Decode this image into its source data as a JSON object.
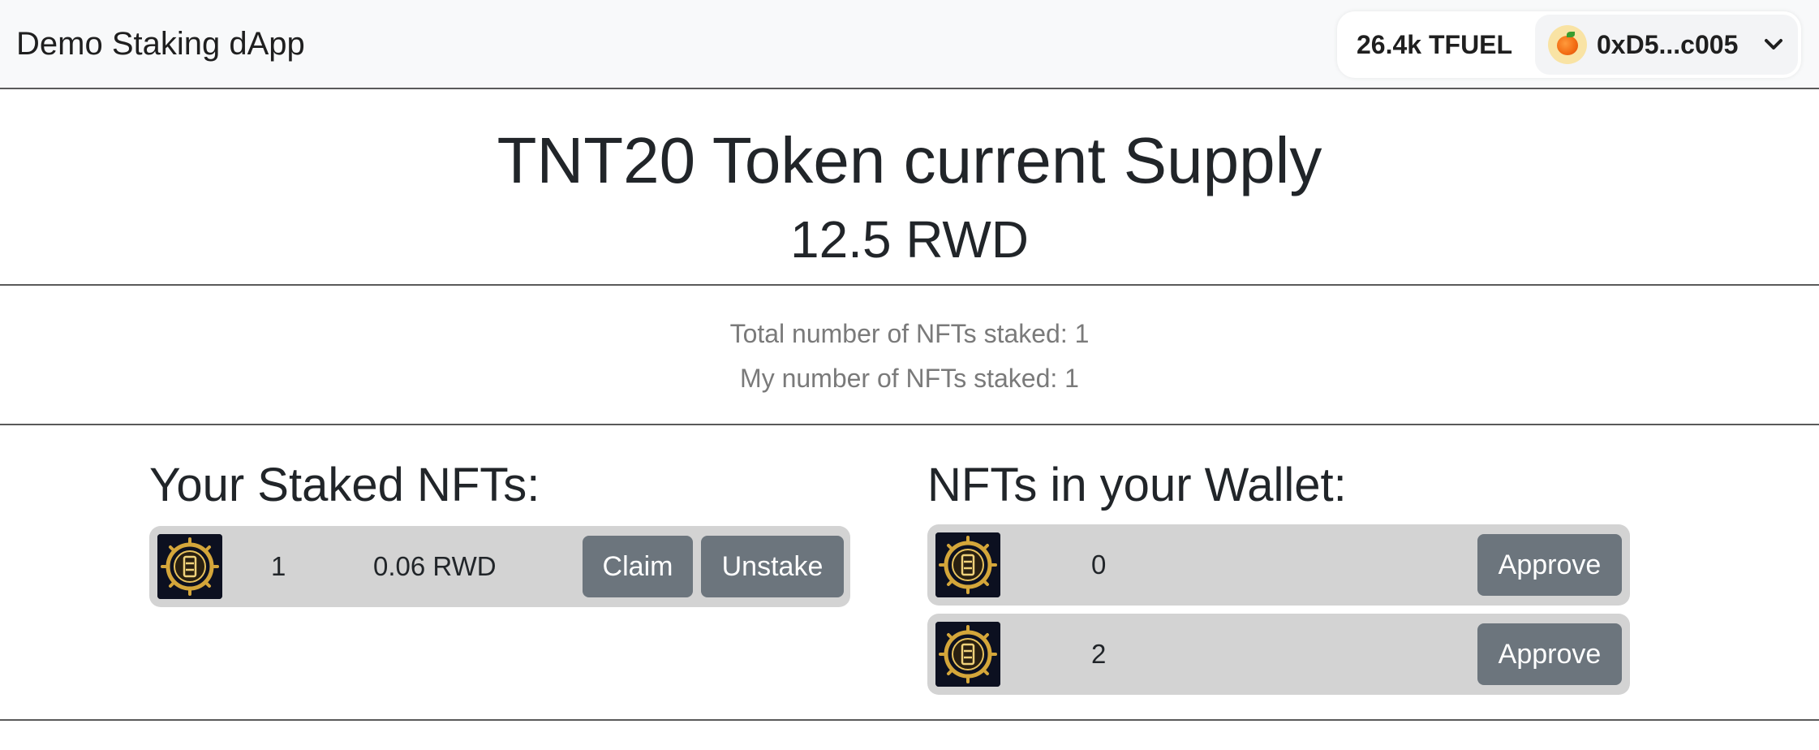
{
  "navbar": {
    "brand": "Demo Staking dApp",
    "balance": "26.4k TFUEL",
    "address": "0xD5...c005",
    "avatar_icon": "orange-fruit-icon",
    "dropdown_icon": "chevron-down-icon"
  },
  "supply": {
    "title": "TNT20 Token current Supply",
    "value": "12.5 RWD"
  },
  "stats": {
    "total_staked": "Total number of NFTs staked: 1",
    "my_staked": "My number of NFTs staked: 1"
  },
  "staked": {
    "heading": "Your Staked NFTs:",
    "items": [
      {
        "token_id": "1",
        "reward": "0.06 RWD",
        "claim_label": "Claim",
        "unstake_label": "Unstake"
      }
    ]
  },
  "wallet": {
    "heading": "NFTs in your Wallet:",
    "items": [
      {
        "token_id": "0",
        "approve_label": "Approve"
      },
      {
        "token_id": "2",
        "approve_label": "Approve"
      }
    ]
  },
  "colors": {
    "navbar_bg": "#f8f9fa",
    "row_bg": "#d3d3d3",
    "button_bg": "#6c757d",
    "stat_text": "#7a7a7a",
    "nft_bg": "#0c1020",
    "nft_gold": "#d4a63a"
  }
}
